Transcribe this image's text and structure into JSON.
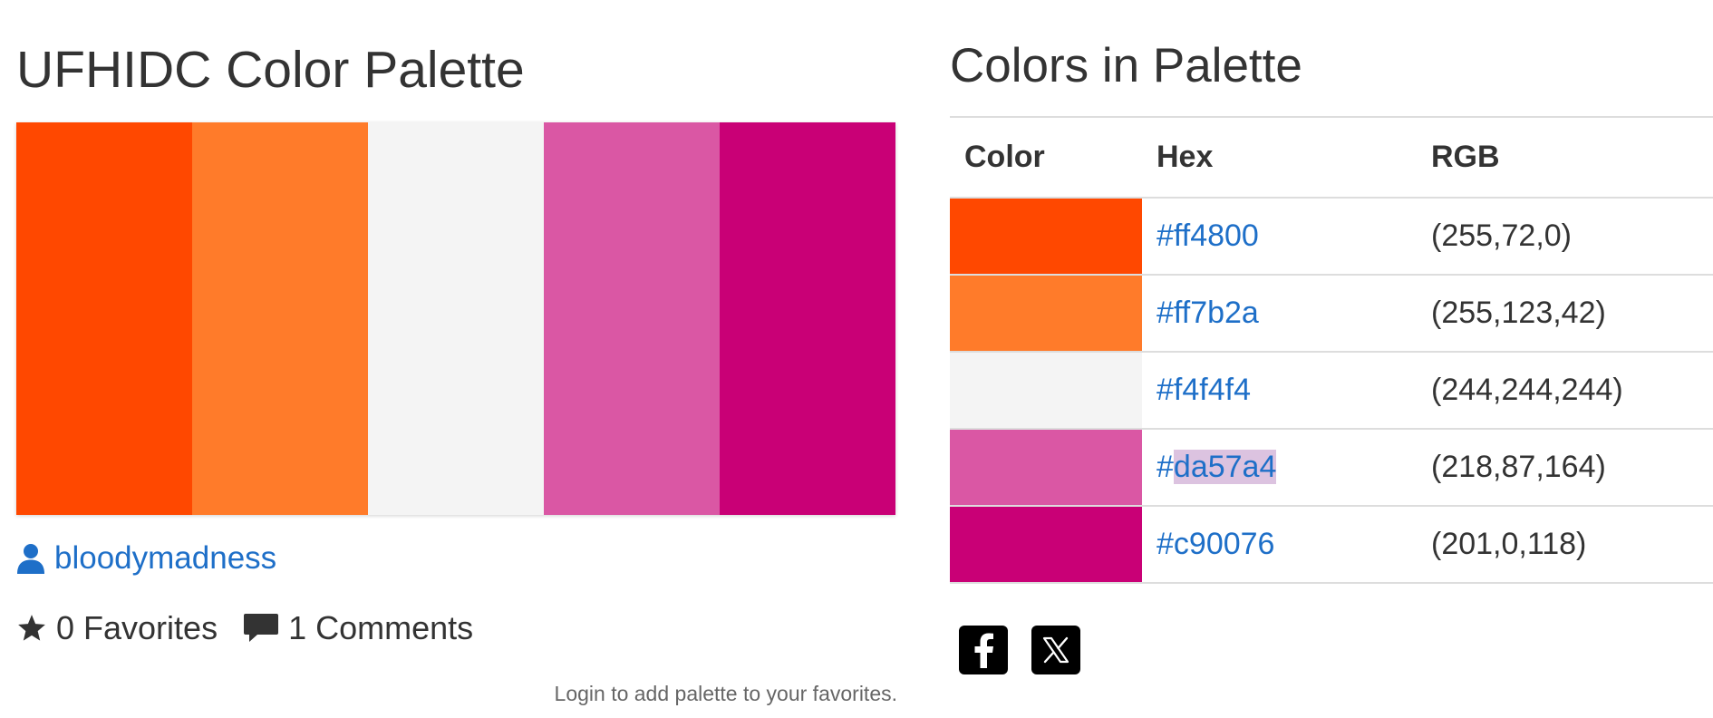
{
  "palette": {
    "title": "UFHIDC Color Palette",
    "colors": [
      "#ff4800",
      "#ff7b2a",
      "#f4f4f4",
      "#da57a4",
      "#c90076"
    ]
  },
  "author": {
    "icon": "user-icon",
    "name": "bloodymadness"
  },
  "stats": {
    "favorites_icon": "star-icon",
    "favorites_text": "0 Favorites",
    "comments_icon": "comment-icon",
    "comments_text": "1 Comments"
  },
  "login_note": "Login to add palette to your favorites.",
  "colors_table": {
    "title": "Colors in Palette",
    "headers": [
      "Color",
      "Hex",
      "RGB"
    ],
    "rows": [
      {
        "hex": "#ff4800",
        "rgb": "(255,72,0)",
        "swatch": "#ff4800"
      },
      {
        "hex": "#ff7b2a",
        "rgb": "(255,123,42)",
        "swatch": "#ff7b2a"
      },
      {
        "hex": "#f4f4f4",
        "rgb": "(244,244,244)",
        "swatch": "#f4f4f4"
      },
      {
        "hex": "#",
        "hex_selected": "da57a4",
        "rgb": "(218,87,164)",
        "swatch": "#da57a4"
      },
      {
        "hex": "#c90076",
        "rgb": "(201,0,118)",
        "swatch": "#c90076"
      }
    ]
  },
  "social": [
    {
      "name": "facebook-icon"
    },
    {
      "name": "x-icon"
    }
  ],
  "colors": {
    "link": "#1e6fc8",
    "text": "#333333",
    "selection": "#dcc3e0"
  }
}
